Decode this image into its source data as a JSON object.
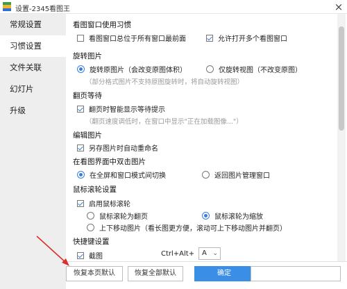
{
  "window": {
    "title": "设置-2345看图王",
    "close_glyph": "×"
  },
  "sidebar": {
    "items": [
      {
        "label": "常规设置"
      },
      {
        "label": "习惯设置"
      },
      {
        "label": "文件关联"
      },
      {
        "label": "幻灯片"
      },
      {
        "label": "升级"
      }
    ],
    "active_index": 1
  },
  "sections": {
    "window_habits": {
      "title": "看图窗口使用习惯",
      "always_on_top": {
        "label": "看图窗口总位于所有窗口最前面",
        "checked": false
      },
      "allow_multiple": {
        "label": "允许打开多个看图窗口",
        "checked": true
      }
    },
    "rotate": {
      "title": "旋转图片",
      "rotate_original": {
        "label": "旋转原图片（会改变原图体积）",
        "checked": true
      },
      "rotate_view": {
        "label": "仅旋转视图（不改变原图）",
        "checked": false
      },
      "note": "（部分格式图片不支持原图旋转时，将自动旋转视图）"
    },
    "page_turn": {
      "title": "翻页等待",
      "smart_wait": {
        "label": "翻页时智能显示等待提示",
        "checked": true
      },
      "note": "（翻页速度调低时，在窗口中显示\"正在加载图像...\"）"
    },
    "edit": {
      "title": "编辑图片",
      "auto_rename": {
        "label": "另存图片时自动重命名",
        "checked": true
      }
    },
    "double_click": {
      "title": "在看图界面中双击图片",
      "toggle_fullscreen": {
        "label": "在全屏和窗口模式间切换",
        "checked": true
      },
      "return_manager": {
        "label": "返回图片管理窗口",
        "checked": false
      }
    },
    "wheel": {
      "title": "鼠标滚轮设置",
      "enable": {
        "label": "启用鼠标滚轮",
        "checked": true
      },
      "page_turn": {
        "label": "鼠标滚轮为翻页",
        "checked": false
      },
      "zoom": {
        "label": "鼠标滚轮为缩放",
        "checked": true
      },
      "move": {
        "label": "上下移动图片（看长图更方便，滚动可上下移动图片并翻页）",
        "checked": false
      }
    },
    "shortcuts": {
      "title": "快捷键设置",
      "screenshot": {
        "label": "截图",
        "checked": true
      },
      "combo": "Ctrl+Alt+",
      "key_value": "A"
    }
  },
  "footer": {
    "restore_page": "恢复本页默认",
    "restore_all": "恢复全部默认",
    "ok": "确定",
    "cancel": ""
  },
  "colors": {
    "accent": "#3a8ee6",
    "check": "#3a7de0",
    "annotation_arrow": "#d9302c"
  }
}
